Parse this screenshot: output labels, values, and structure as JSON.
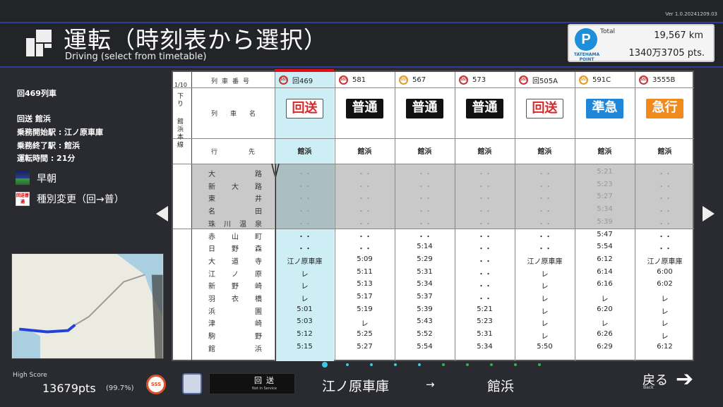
{
  "version": "Ver 1.0.20241209.03",
  "header": {
    "title": "運転（時刻表から選択）",
    "subtitle": "Driving (select from timetable)"
  },
  "points": {
    "logo": "P",
    "brand": "TATEHAMA POINT",
    "total_label": "Total",
    "distance": "19,567 km",
    "points": "1340万3705 pts."
  },
  "train_info": {
    "train_number": "回469列車",
    "type_dest": "回送 館浜",
    "start_station": "乗務開始駅 : 江ノ原車庫",
    "end_station": "乗務終了駅 : 館浜",
    "duration": "運転時間 : 21分",
    "condition_label": "早朝",
    "badge_change_text": "回送普通",
    "change_label": "種別変更（回→普）"
  },
  "timetable": {
    "page": "1/10",
    "direction": "下り",
    "line_name": "館浜本線",
    "row_headers": {
      "train_number": "列車番号",
      "train_name": "列車名",
      "destination": "行先"
    },
    "columns": [
      {
        "number": "回469",
        "type": "回送",
        "type_style": "outline",
        "dest": "館浜",
        "selected": true,
        "sss_color": "red"
      },
      {
        "number": "581",
        "type": "普通",
        "type_style": "black",
        "dest": "館浜",
        "selected": false,
        "sss_color": "red"
      },
      {
        "number": "567",
        "type": "普通",
        "type_style": "black",
        "dest": "館浜",
        "selected": false,
        "sss_color": "orange"
      },
      {
        "number": "573",
        "type": "普通",
        "type_style": "black",
        "dest": "館浜",
        "selected": false,
        "sss_color": "red"
      },
      {
        "number": "回505A",
        "type": "回送",
        "type_style": "outline",
        "dest": "館浜",
        "selected": false,
        "sss_color": "red"
      },
      {
        "number": "591C",
        "type": "準急",
        "type_style": "blue",
        "dest": "館浜",
        "selected": false,
        "sss_color": "orange"
      },
      {
        "number": "3555B",
        "type": "急行",
        "type_style": "orange",
        "dest": "館浜",
        "selected": false,
        "sss_color": "red"
      }
    ],
    "stations": [
      "大路",
      "新大路",
      "東井",
      "名田",
      "珠川温泉",
      "赤山町",
      "日野森",
      "大道寺",
      "江ノ原",
      "新野崎",
      "羽衣橋",
      "浜園",
      "津崎",
      "駒野",
      "館浜"
    ],
    "greyed_rows": 5,
    "times": [
      [
        "・・",
        "・・",
        "・・",
        "・・",
        "・・",
        "5:21",
        "・・"
      ],
      [
        "・・",
        "・・",
        "・・",
        "・・",
        "・・",
        "5:23",
        "・・"
      ],
      [
        "・・",
        "・・",
        "・・",
        "・・",
        "・・",
        "5:27",
        "・・"
      ],
      [
        "・・",
        "・・",
        "・・",
        "・・",
        "・・",
        "5:34",
        "・・"
      ],
      [
        "・・",
        "・・",
        "・・",
        "・・",
        "・・",
        "5:39",
        "・・"
      ],
      [
        "・・",
        "・・",
        "・・",
        "・・",
        "・・",
        "5:47",
        "・・"
      ],
      [
        "・・",
        "・・",
        "5:14",
        "・・",
        "・・",
        "5:54",
        "・・"
      ],
      [
        "江ノ原車庫",
        "5:09",
        "5:29",
        "・・",
        "江ノ原車庫",
        "6:12",
        "江ノ原車庫"
      ],
      [
        "レ",
        "5:11",
        "5:31",
        "・・",
        "レ",
        "6:14",
        "6:00"
      ],
      [
        "レ",
        "5:13",
        "5:34",
        "・・",
        "レ",
        "6:16",
        "6:02"
      ],
      [
        "レ",
        "5:17",
        "5:37",
        "・・",
        "レ",
        "レ",
        "レ"
      ],
      [
        "5:01",
        "5:19",
        "5:39",
        "5:21",
        "レ",
        "6:20",
        "レ"
      ],
      [
        "5:03",
        "レ",
        "5:43",
        "5:23",
        "レ",
        "レ",
        "レ"
      ],
      [
        "5:12",
        "5:25",
        "5:52",
        "5:31",
        "レ",
        "6:26",
        "レ"
      ],
      [
        "5:15",
        "5:27",
        "5:54",
        "5:34",
        "5:50",
        "6:29",
        "6:12"
      ]
    ]
  },
  "footer": {
    "high_score_label": "High Score",
    "high_score": "13679pts",
    "high_score_percent": "(99.7%)",
    "sss_label": "SSS",
    "sign_main": "回送",
    "sign_sub": "Not in Service",
    "from": "江ノ原車庫",
    "arrow": "→",
    "to": "館浜",
    "back_label": "戻る",
    "back_sub": "Back",
    "back_arrow": "➔"
  },
  "colors": {
    "accent_blue": "#2d3c9a",
    "selected_column": "#cdeef4",
    "selected_marker": "#e0101b",
    "greyed_rows": "#c8c8c8",
    "type_blue": "#1f86d9",
    "type_orange": "#f08a1c",
    "outline_red": "#d12a2a"
  }
}
